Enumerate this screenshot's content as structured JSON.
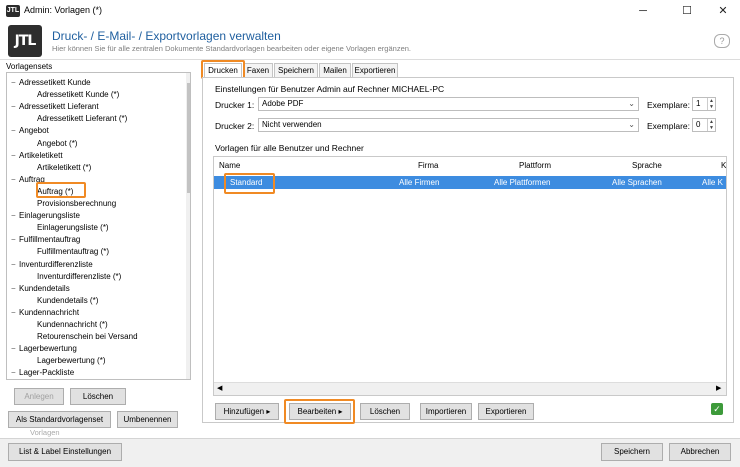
{
  "window": {
    "logo": "JTL",
    "title": "Admin: Vorlagen (*)",
    "controls": [
      "─",
      "☐",
      "✕"
    ]
  },
  "header": {
    "logo": "JTL",
    "title": "Druck- / E-Mail- / Exportvorlagen verwalten",
    "subtitle": "Hier können Sie für alle zentralen Dokumente Standardvorlagen bearbeiten oder eigene Vorlagen ergänzen."
  },
  "sidebar": {
    "label": "Vorlagensets",
    "tree": [
      {
        "label": "Adressetikett Kunde",
        "level": 0
      },
      {
        "label": "Adressetikett Kunde (*)",
        "level": 1
      },
      {
        "label": "Adressetikett Lieferant",
        "level": 0
      },
      {
        "label": "Adressetikett Lieferant (*)",
        "level": 1
      },
      {
        "label": "Angebot",
        "level": 0
      },
      {
        "label": "Angebot (*)",
        "level": 1
      },
      {
        "label": "Artikeletikett",
        "level": 0
      },
      {
        "label": "Artikeletikett (*)",
        "level": 1
      },
      {
        "label": "Auftrag",
        "level": 0
      },
      {
        "label": "Auftrag (*)",
        "level": 1
      },
      {
        "label": "Provisionsberechnung",
        "level": 1
      },
      {
        "label": "Einlagerungsliste",
        "level": 0
      },
      {
        "label": "Einlagerungsliste (*)",
        "level": 1
      },
      {
        "label": "Fulfillmentauftrag",
        "level": 0
      },
      {
        "label": "Fulfillmentauftrag (*)",
        "level": 1
      },
      {
        "label": "Inventurdifferenzliste",
        "level": 0
      },
      {
        "label": "Inventurdifferenzliste (*)",
        "level": 1
      },
      {
        "label": "Kundendetails",
        "level": 0
      },
      {
        "label": "Kundendetails (*)",
        "level": 1
      },
      {
        "label": "Kundennachricht",
        "level": 0
      },
      {
        "label": "Kundennachricht (*)",
        "level": 1
      },
      {
        "label": "Retourenschein bei Versand",
        "level": 1
      },
      {
        "label": "Lagerbewertung",
        "level": 0
      },
      {
        "label": "Lagerbewertung (*)",
        "level": 1
      },
      {
        "label": "Lager-Packliste",
        "level": 0
      }
    ],
    "btn_anlegen": "Anlegen",
    "btn_loeschen": "Löschen",
    "btn_standard": "Als Standardvorlagenset",
    "btn_umbenennen": "Umbenennen",
    "group_label": "Vorlagen"
  },
  "tabs": [
    "Drucken",
    "Faxen",
    "Speichern",
    "Mailen",
    "Exportieren"
  ],
  "print": {
    "settings_label": "Einstellungen für Benutzer Admin auf Rechner MICHAEL-PC",
    "printer1_label": "Drucker 1:",
    "printer1_value": "Adobe PDF",
    "printer2_label": "Drucker 2:",
    "printer2_value": "Nicht verwenden",
    "copies_label": "Exemplare:",
    "copies1": "1",
    "copies2": "0",
    "templates_label": "Vorlagen für alle Benutzer und Rechner",
    "columns": [
      "Name",
      "Firma",
      "Plattform",
      "Sprache",
      "K"
    ],
    "rows": [
      {
        "name": "Standard",
        "firma": "Alle Firmen",
        "plattform": "Alle Plattformen",
        "sprache": "Alle Sprachen",
        "k": "Alle K"
      }
    ],
    "btn_hinzufuegen": "Hinzufügen",
    "btn_bearbeiten": "Bearbeiten",
    "btn_loeschen": "Löschen",
    "btn_importieren": "Importieren",
    "btn_exportieren": "Exportieren"
  },
  "footer": {
    "btn_list_label": "List & Label Einstellungen",
    "btn_speichern": "Speichern",
    "btn_abbrechen": "Abbrechen"
  },
  "colors": {
    "accent": "#f08a24",
    "selection": "#3d8ce0",
    "title": "#1f5f9f"
  }
}
